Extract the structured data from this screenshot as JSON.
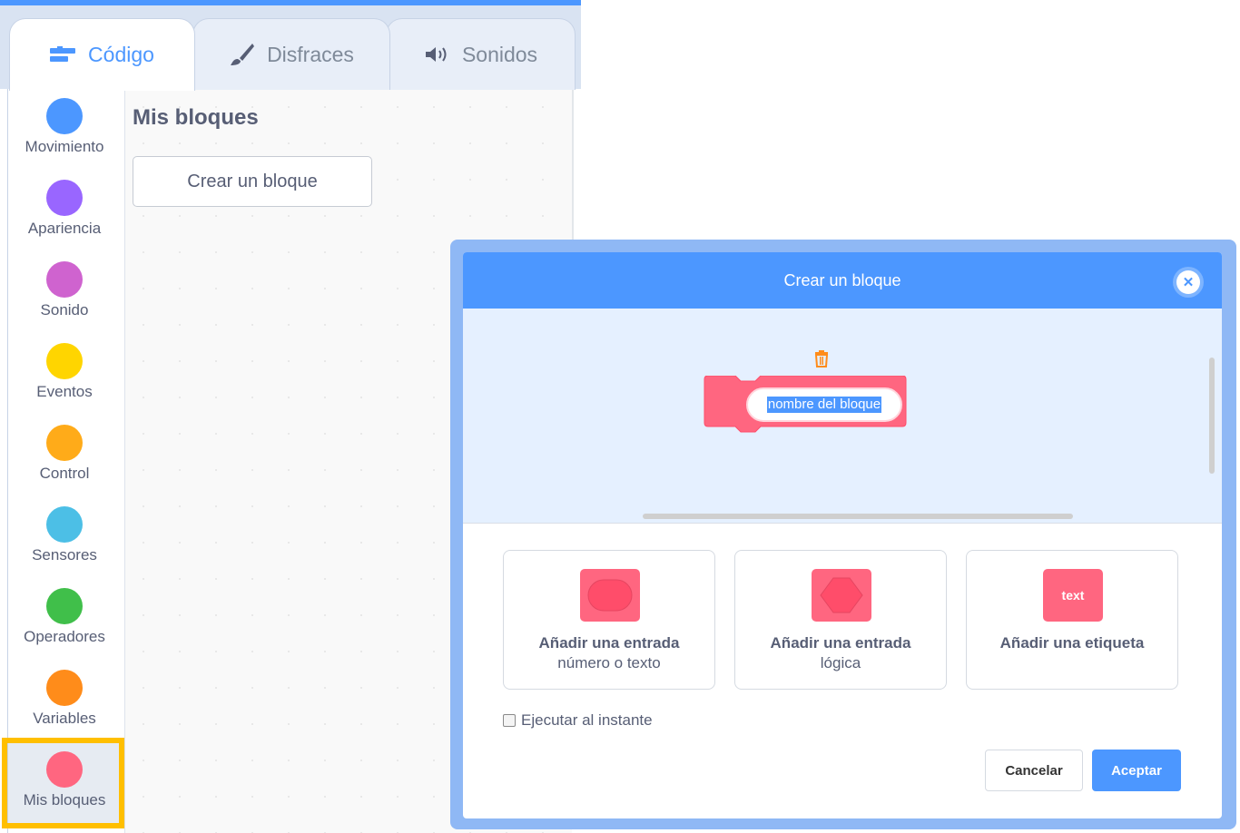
{
  "tabs": [
    {
      "label": "Código",
      "icon": "code-icon",
      "active": true
    },
    {
      "label": "Disfraces",
      "icon": "paintbrush-icon",
      "active": false
    },
    {
      "label": "Sonidos",
      "icon": "speaker-icon",
      "active": false
    }
  ],
  "categories": [
    {
      "label": "Movimiento",
      "color": "#4c97ff"
    },
    {
      "label": "Apariencia",
      "color": "#9966ff"
    },
    {
      "label": "Sonido",
      "color": "#cf63cf"
    },
    {
      "label": "Eventos",
      "color": "#ffd500"
    },
    {
      "label": "Control",
      "color": "#ffab19"
    },
    {
      "label": "Sensores",
      "color": "#4cbfe6"
    },
    {
      "label": "Operadores",
      "color": "#40bf4a"
    },
    {
      "label": "Variables",
      "color": "#ff8c1a"
    },
    {
      "label": "Mis bloques",
      "color": "#ff6680",
      "selected": true
    }
  ],
  "palette": {
    "title": "Mis bloques",
    "make_block_label": "Crear un bloque"
  },
  "modal": {
    "title": "Crear un bloque",
    "close_icon": "close-icon",
    "block_name": "nombre del bloque",
    "options": [
      {
        "title": "Añadir una entrada",
        "subtitle": "número o texto",
        "icon": "number-input-icon"
      },
      {
        "title": "Añadir una entrada",
        "subtitle": "lógica",
        "icon": "boolean-input-icon"
      },
      {
        "title": "Añadir una etiqueta",
        "subtitle": "",
        "icon": "label-icon",
        "chip_text": "text"
      }
    ],
    "run_without_refresh_label": "Ejecutar al instante",
    "run_without_refresh_checked": false,
    "cancel_label": "Cancelar",
    "ok_label": "Aceptar"
  },
  "colors": {
    "accent": "#4c97ff",
    "my_blocks": "#ff6680",
    "highlight": "#ffbf00"
  }
}
